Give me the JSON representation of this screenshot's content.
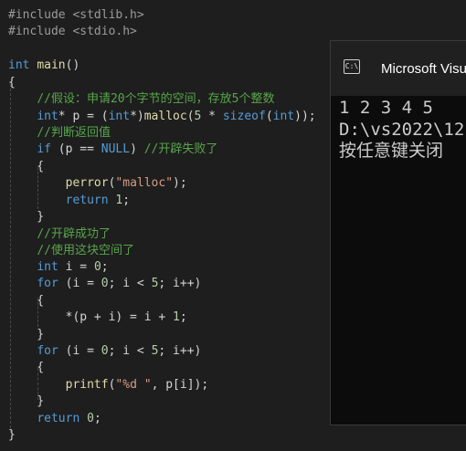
{
  "editor": {
    "lines": [
      [
        {
          "c": "pp",
          "t": "#include <stdlib.h>"
        }
      ],
      [
        {
          "c": "pp",
          "t": "#include <stdio.h>"
        }
      ],
      [],
      [
        {
          "c": "kw",
          "t": "int"
        },
        {
          "c": "pl",
          "t": " "
        },
        {
          "c": "fn",
          "t": "main"
        },
        {
          "c": "pl",
          "t": "()"
        }
      ],
      [
        {
          "c": "pl",
          "t": "{"
        }
      ],
      [
        {
          "c": "pl",
          "t": "    "
        },
        {
          "c": "cm",
          "t": "//假设：申请20个字节的空间，存放5个整数"
        }
      ],
      [
        {
          "c": "pl",
          "t": "    "
        },
        {
          "c": "kw",
          "t": "int"
        },
        {
          "c": "pl",
          "t": "* p = ("
        },
        {
          "c": "kw",
          "t": "int"
        },
        {
          "c": "pl",
          "t": "*)"
        },
        {
          "c": "fn",
          "t": "malloc"
        },
        {
          "c": "pl",
          "t": "("
        },
        {
          "c": "num",
          "t": "5"
        },
        {
          "c": "pl",
          "t": " * "
        },
        {
          "c": "kw",
          "t": "sizeof"
        },
        {
          "c": "pl",
          "t": "("
        },
        {
          "c": "kw",
          "t": "int"
        },
        {
          "c": "pl",
          "t": "));"
        }
      ],
      [
        {
          "c": "pl",
          "t": "    "
        },
        {
          "c": "cm",
          "t": "//判断返回值"
        }
      ],
      [
        {
          "c": "pl",
          "t": "    "
        },
        {
          "c": "kw",
          "t": "if"
        },
        {
          "c": "pl",
          "t": " (p == "
        },
        {
          "c": "kw",
          "t": "NULL"
        },
        {
          "c": "pl",
          "t": ") "
        },
        {
          "c": "cm",
          "t": "//开辟失败了"
        }
      ],
      [
        {
          "c": "pl",
          "t": "    {"
        }
      ],
      [
        {
          "c": "pl",
          "t": "        "
        },
        {
          "c": "fn",
          "t": "perror"
        },
        {
          "c": "pl",
          "t": "("
        },
        {
          "c": "str",
          "t": "\"malloc\""
        },
        {
          "c": "pl",
          "t": ");"
        }
      ],
      [
        {
          "c": "pl",
          "t": "        "
        },
        {
          "c": "kw",
          "t": "return"
        },
        {
          "c": "pl",
          "t": " "
        },
        {
          "c": "num",
          "t": "1"
        },
        {
          "c": "pl",
          "t": ";"
        }
      ],
      [
        {
          "c": "pl",
          "t": "    }"
        }
      ],
      [
        {
          "c": "pl",
          "t": "    "
        },
        {
          "c": "cm",
          "t": "//开辟成功了"
        }
      ],
      [
        {
          "c": "pl",
          "t": "    "
        },
        {
          "c": "cm",
          "t": "//使用这块空间了"
        }
      ],
      [
        {
          "c": "pl",
          "t": "    "
        },
        {
          "c": "kw",
          "t": "int"
        },
        {
          "c": "pl",
          "t": " i = "
        },
        {
          "c": "num",
          "t": "0"
        },
        {
          "c": "pl",
          "t": ";"
        }
      ],
      [
        {
          "c": "pl",
          "t": "    "
        },
        {
          "c": "kw",
          "t": "for"
        },
        {
          "c": "pl",
          "t": " (i = "
        },
        {
          "c": "num",
          "t": "0"
        },
        {
          "c": "pl",
          "t": "; i < "
        },
        {
          "c": "num",
          "t": "5"
        },
        {
          "c": "pl",
          "t": "; i++)"
        }
      ],
      [
        {
          "c": "pl",
          "t": "    {"
        }
      ],
      [
        {
          "c": "pl",
          "t": "        *(p + i) = i + "
        },
        {
          "c": "num",
          "t": "1"
        },
        {
          "c": "pl",
          "t": ";"
        }
      ],
      [
        {
          "c": "pl",
          "t": "    }"
        }
      ],
      [
        {
          "c": "pl",
          "t": "    "
        },
        {
          "c": "kw",
          "t": "for"
        },
        {
          "c": "pl",
          "t": " (i = "
        },
        {
          "c": "num",
          "t": "0"
        },
        {
          "c": "pl",
          "t": "; i < "
        },
        {
          "c": "num",
          "t": "5"
        },
        {
          "c": "pl",
          "t": "; i++)"
        }
      ],
      [
        {
          "c": "pl",
          "t": "    {"
        }
      ],
      [
        {
          "c": "pl",
          "t": "        "
        },
        {
          "c": "fn",
          "t": "printf"
        },
        {
          "c": "pl",
          "t": "("
        },
        {
          "c": "str",
          "t": "\"%d \""
        },
        {
          "c": "pl",
          "t": ", p[i]);"
        }
      ],
      [
        {
          "c": "pl",
          "t": "    }"
        }
      ],
      [
        {
          "c": "pl",
          "t": "    "
        },
        {
          "c": "kw",
          "t": "return"
        },
        {
          "c": "pl",
          "t": " "
        },
        {
          "c": "num",
          "t": "0"
        },
        {
          "c": "pl",
          "t": ";"
        }
      ],
      [
        {
          "c": "pl",
          "t": "}"
        }
      ]
    ]
  },
  "terminal": {
    "title": "Microsoft Visu",
    "icon": "terminal-icon",
    "icon_glyph": "C:\\",
    "output_lines": [
      "1 2 3 4 5",
      "D:\\vs2022\\12",
      "按任意键关闭"
    ]
  }
}
